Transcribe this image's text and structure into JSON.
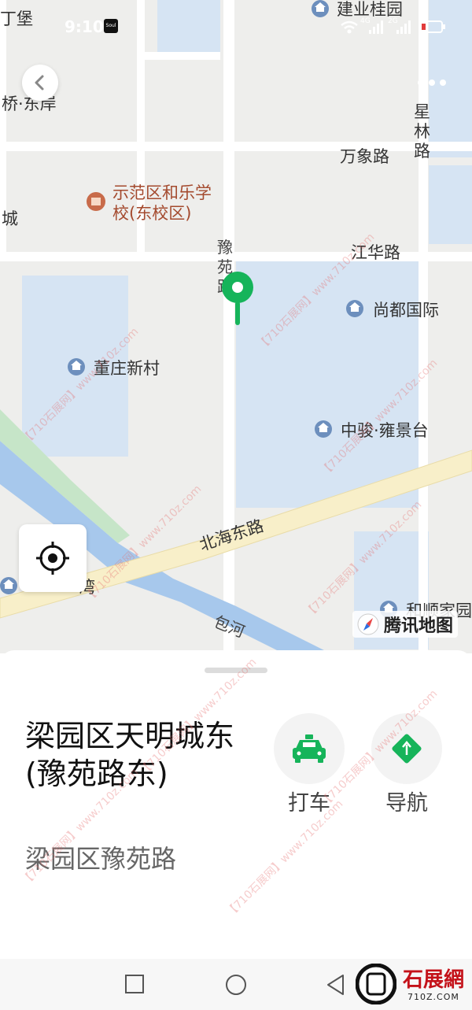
{
  "status_bar": {
    "time": "9:10",
    "app_icon_label": "Soul",
    "network_1": "4G",
    "network_2": "2G"
  },
  "map": {
    "labels": {
      "top_left": "丁堡",
      "left_mid": "桥·东岸",
      "left_city": "城",
      "jianye": "建业桂园",
      "xinglin": "星林路",
      "wanxiang": "万象路",
      "school": "示范区和乐学校(东校区)",
      "yuyuan": "豫苑路",
      "jianghua": "江华路",
      "shangdu": "尚都国际",
      "dongzhuang": "董庄新村",
      "zhongjun": "中骏·雍景台",
      "beihai": "北海东路",
      "baohe": "包河",
      "heshun": "和顺家园",
      "bottom_left": "湾"
    },
    "brand": "腾讯地图",
    "colors": {
      "pin": "#16b45a",
      "water": "#a7c8ec",
      "block": "#d6e4f3",
      "road": "#ffffff",
      "main_road": "#f8efc9"
    }
  },
  "sheet": {
    "title_line1": "梁园区天明城东",
    "title_line2": "(豫苑路东)",
    "subtitle": "梁园区豫苑路",
    "taxi_label": "打车",
    "nav_label": "导航"
  },
  "watermark": {
    "text": "【710石展网】www.710z.com",
    "logo_text": "石展網",
    "logo_sub": "710Z.COM"
  }
}
